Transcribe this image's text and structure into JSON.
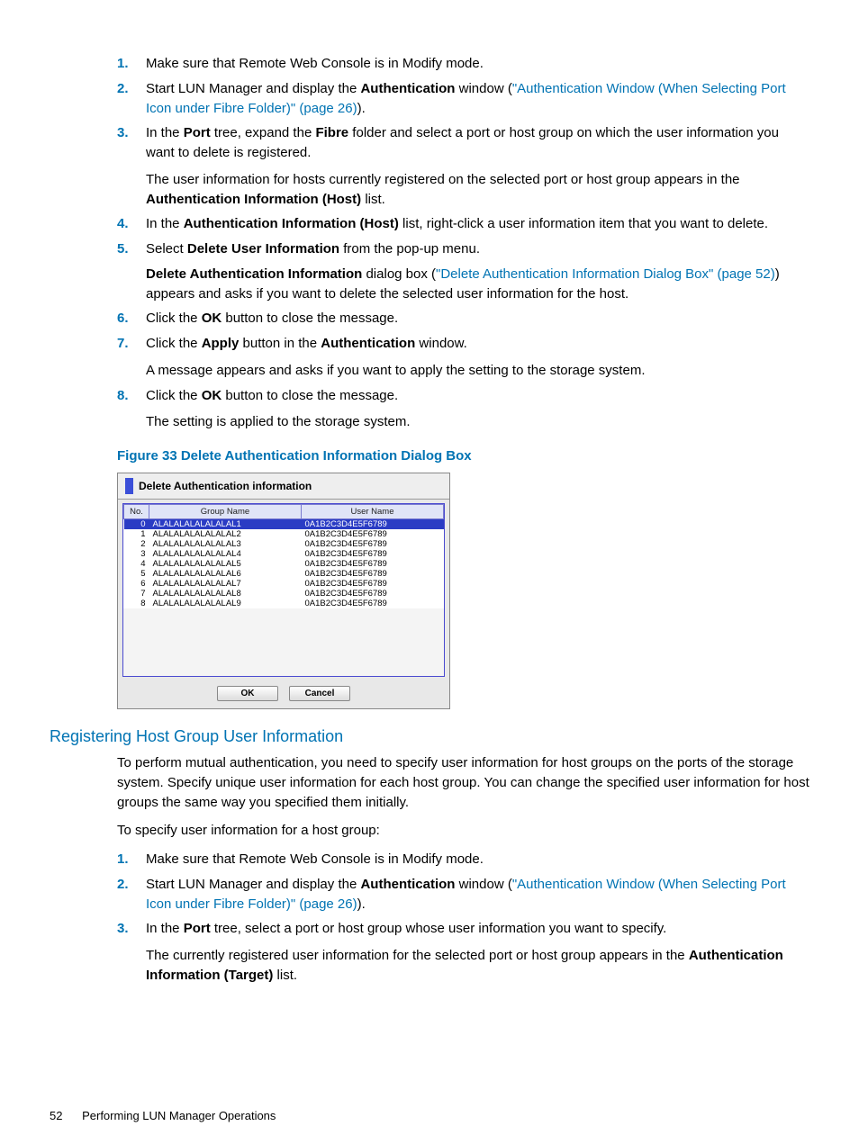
{
  "list1": {
    "step1": {
      "num": "1.",
      "text": "Make sure that Remote Web Console is in Modify mode."
    },
    "step2": {
      "num": "2.",
      "pre": "Start LUN Manager and display the ",
      "auth": "Authentication",
      "mid": " window (",
      "link": "\"Authentication Window (When Selecting Port Icon under Fibre Folder)\" (page 26)",
      "end": ")."
    },
    "step3": {
      "num": "3.",
      "p1a": "In the ",
      "p1b": "Port",
      "p1c": " tree, expand the ",
      "p1d": "Fibre",
      "p1e": " folder and select a port or host group on which the user information you want to delete is registered.",
      "p2a": "The user information for hosts currently registered on the selected port or host group appears in the ",
      "p2b": "Authentication Information (Host)",
      "p2c": " list."
    },
    "step4": {
      "num": "4.",
      "a": "In the ",
      "b": "Authentication Information (Host)",
      "c": " list, right-click a user information item that you want to delete."
    },
    "step5": {
      "num": "5.",
      "p1a": "Select ",
      "p1b": "Delete User Information",
      "p1c": " from the pop-up menu.",
      "p2a": "Delete Authentication Information",
      "p2b": " dialog box (",
      "p2link": "\"Delete Authentication Information Dialog Box\" (page 52)",
      "p2c": ") appears and asks if you want to delete the selected user information for the host."
    },
    "step6": {
      "num": "6.",
      "a": "Click the ",
      "b": "OK",
      "c": " button to close the message."
    },
    "step7": {
      "num": "7.",
      "p1a": "Click the ",
      "p1b": "Apply",
      "p1c": " button in the ",
      "p1d": "Authentication",
      "p1e": " window.",
      "p2": "A message appears and asks if you want to apply the setting to the storage system."
    },
    "step8": {
      "num": "8.",
      "p1a": "Click the ",
      "p1b": "OK",
      "p1c": " button to close the message.",
      "p2": "The setting is applied to the storage system."
    }
  },
  "figureCaption": "Figure 33 Delete Authentication Information Dialog Box",
  "dialog": {
    "title": "Delete Authentication information",
    "headers": {
      "no": "No.",
      "group": "Group Name",
      "user": "User Name"
    },
    "rows": [
      {
        "no": "0",
        "group": "ALALALALALALALAL1",
        "user": "0A1B2C3D4E5F6789"
      },
      {
        "no": "1",
        "group": "ALALALALALALALAL2",
        "user": "0A1B2C3D4E5F6789"
      },
      {
        "no": "2",
        "group": "ALALALALALALALAL3",
        "user": "0A1B2C3D4E5F6789"
      },
      {
        "no": "3",
        "group": "ALALALALALALALAL4",
        "user": "0A1B2C3D4E5F6789"
      },
      {
        "no": "4",
        "group": "ALALALALALALALAL5",
        "user": "0A1B2C3D4E5F6789"
      },
      {
        "no": "5",
        "group": "ALALALALALALALAL6",
        "user": "0A1B2C3D4E5F6789"
      },
      {
        "no": "6",
        "group": "ALALALALALALALAL7",
        "user": "0A1B2C3D4E5F6789"
      },
      {
        "no": "7",
        "group": "ALALALALALALALAL8",
        "user": "0A1B2C3D4E5F6789"
      },
      {
        "no": "8",
        "group": "ALALALALALALALAL9",
        "user": "0A1B2C3D4E5F6789"
      }
    ],
    "ok": "OK",
    "cancel": "Cancel"
  },
  "sectionHeading": "Registering Host Group User Information",
  "sectionPara1": "To perform mutual authentication, you need to specify user information for host groups on the ports of the storage system. Specify unique user information for each host group. You can change the specified user information for host groups the same way you specified them initially.",
  "sectionPara2": "To specify user information for a host group:",
  "list2": {
    "step1": {
      "num": "1.",
      "text": "Make sure that Remote Web Console is in Modify mode."
    },
    "step2": {
      "num": "2.",
      "pre": "Start LUN Manager and display the ",
      "auth": "Authentication",
      "mid": " window (",
      "link": "\"Authentication Window (When Selecting Port Icon under Fibre Folder)\" (page 26)",
      "end": ")."
    },
    "step3": {
      "num": "3.",
      "p1a": "In the ",
      "p1b": "Port",
      "p1c": " tree, select a port or host group whose user information you want to specify.",
      "p2a": "The currently registered user information for the selected port or host group appears in the ",
      "p2b": "Authentication Information (Target)",
      "p2c": " list."
    }
  },
  "footer": {
    "page": "52",
    "title": "Performing LUN Manager Operations"
  }
}
